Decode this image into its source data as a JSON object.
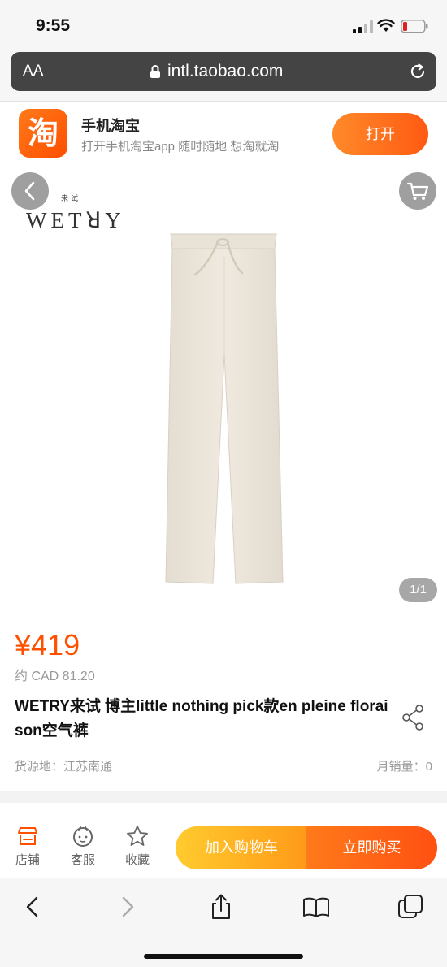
{
  "status_bar": {
    "time": "9:55"
  },
  "browser": {
    "text_size_label": "AA",
    "url": "intl.taobao.com"
  },
  "app_banner": {
    "logo_char": "淘",
    "app_name": "手机淘宝",
    "description": "打开手机淘宝app 随时随地 想淘就淘",
    "open_label": "打开"
  },
  "product_image": {
    "brand_chinese": "来试",
    "brand_name": "WETRY",
    "counter": "1/1",
    "item_color": "#ece6dc"
  },
  "product": {
    "price": "¥419",
    "approx_price": "约 CAD 81.20",
    "title": "WETRY来试 博主little nothing pick款en pleine floraison空气裤",
    "origin": "货源地：江苏南通",
    "monthly_sales": "月销量：0"
  },
  "action_bar": {
    "shop_label": "店铺",
    "service_label": "客服",
    "favorite_label": "收藏",
    "add_to_cart_label": "加入购物车",
    "buy_now_label": "立即购买"
  },
  "icons": [
    "back-icon",
    "cart-icon",
    "share-icon",
    "shop-icon",
    "service-icon",
    "star-icon",
    "lock-icon",
    "reload-icon",
    "chevron-left-icon",
    "chevron-right-icon",
    "share-up-icon",
    "book-icon",
    "tabs-icon"
  ],
  "colors": {
    "accent": "#ff5000",
    "cart_button": "#ffb020",
    "buy_button": "#ff5a12"
  }
}
